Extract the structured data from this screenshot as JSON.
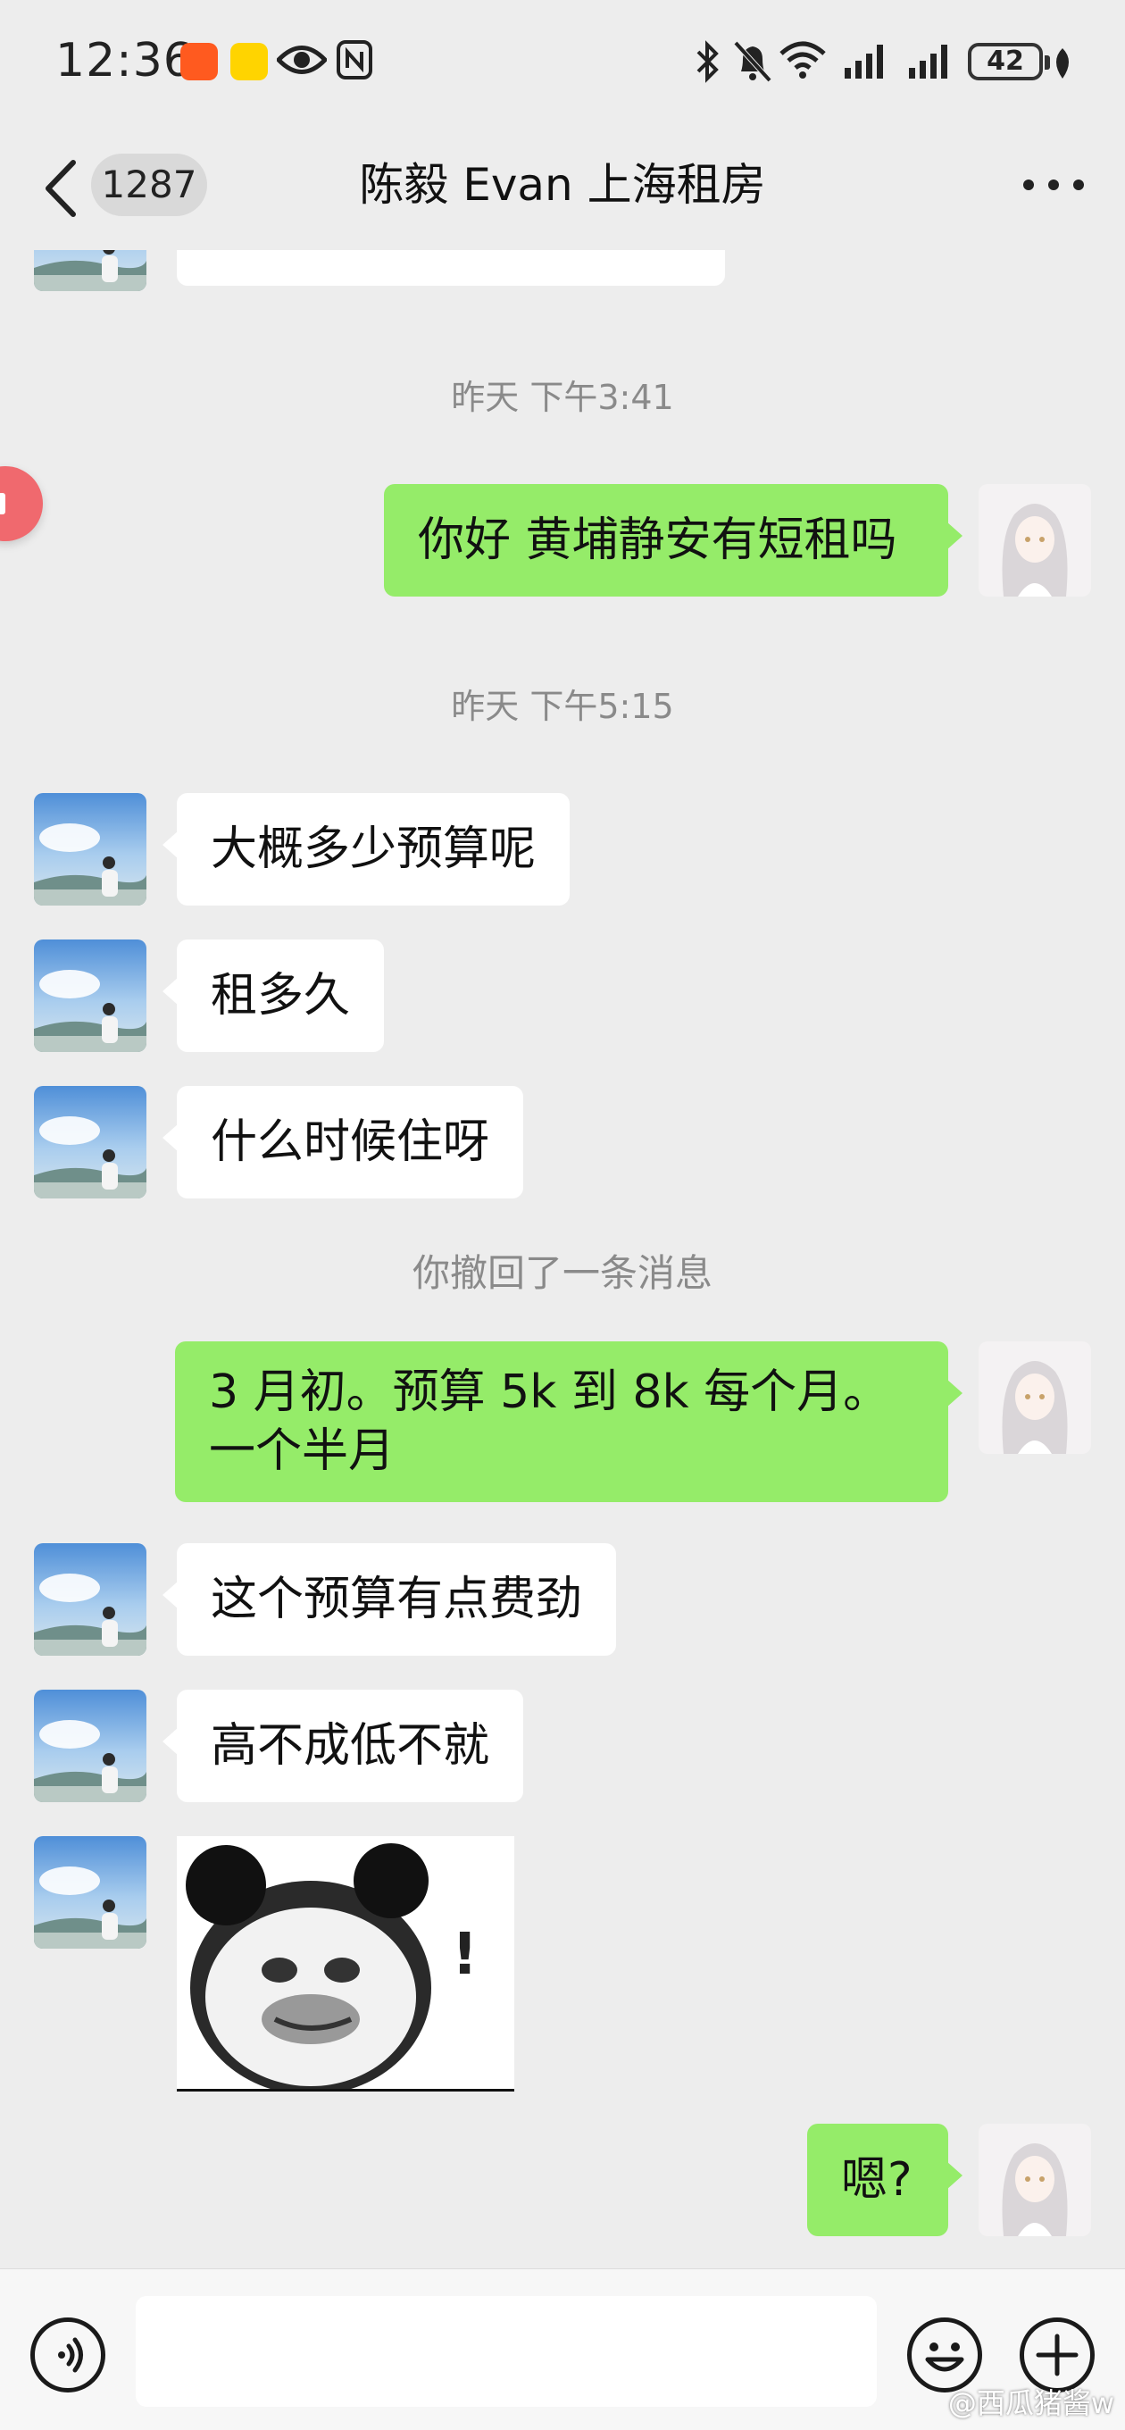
{
  "status_bar": {
    "time": "12:36",
    "battery": "42",
    "icons": [
      "app-orange-icon",
      "app-yellow-icon",
      "eye-icon",
      "nfc-icon",
      "bluetooth-icon",
      "mute-icon",
      "wifi-icon",
      "signal-icon",
      "signal-icon-2",
      "leaf-icon"
    ]
  },
  "nav": {
    "unread_count": "1287",
    "title": "陈毅 Evan 上海租房"
  },
  "chat": {
    "top_partial_text": "",
    "timestamp_1": "昨天 下午3:41",
    "msg_out_1": "你好 黄埔静安有短租吗",
    "timestamp_2": "昨天 下午5:15",
    "msg_in_1": "大概多少预算呢",
    "msg_in_2": "租多久",
    "msg_in_3": "什么时候住呀",
    "recall_note": "你撤回了一条消息",
    "msg_out_2": "3 月初。预算 5k 到 8k 每个月。一个半月",
    "msg_in_4": "这个预算有点费劲",
    "msg_in_5": "高不成低不就",
    "sticker_text": "!",
    "msg_out_3": "嗯?"
  },
  "input": {
    "placeholder": ""
  },
  "watermark": "@西瓜猪酱w",
  "colors": {
    "background": "#ededed",
    "bubble_out": "#95ec69",
    "bubble_in": "#ffffff",
    "float_button": "#f0696e"
  }
}
